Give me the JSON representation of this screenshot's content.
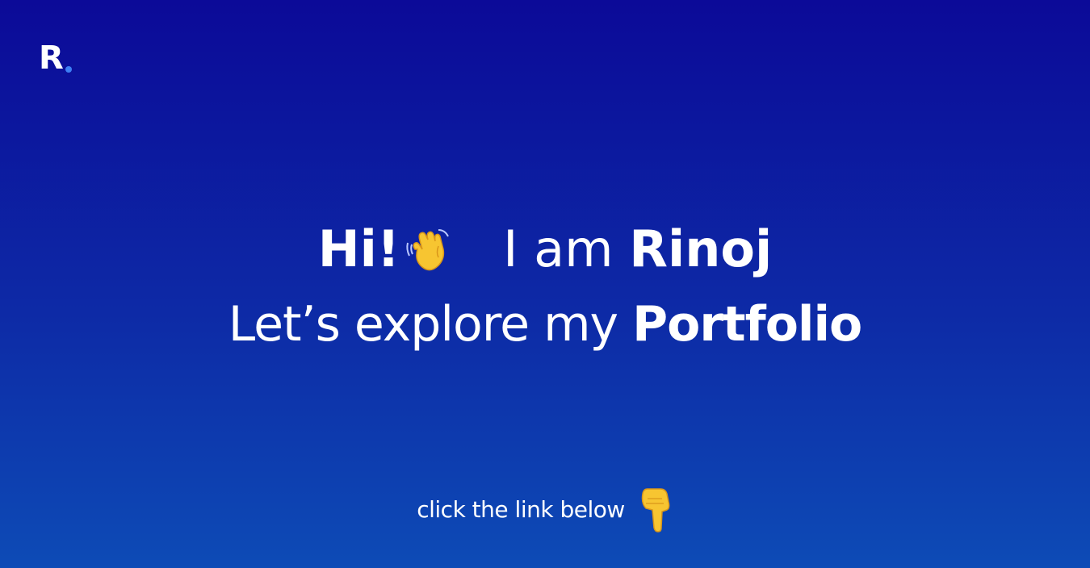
{
  "logo": {
    "letter": "R",
    "dot_color": "#3d7ff5"
  },
  "hero": {
    "greeting": "Hi!",
    "wave_icon": "waving-hand-emoji",
    "intro_prefix": "I am ",
    "name": "Rinoj",
    "explore_prefix": "Let’s explore my ",
    "explore_highlight": "Portfolio"
  },
  "cta": {
    "text": "click the link below",
    "icon": "pointing-down-hand-emoji"
  },
  "colors": {
    "background_top": "#0c0a98",
    "background_bottom": "#0d4bb6",
    "text": "#ffffff",
    "emoji_yellow": "#f7c531"
  }
}
